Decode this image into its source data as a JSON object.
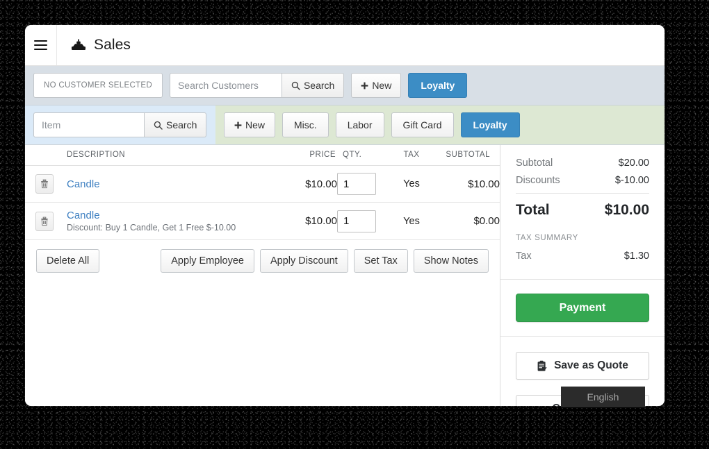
{
  "app": {
    "title": "Sales",
    "title_icon": "cash-register-icon",
    "menu_icon": "hamburger-menu-icon"
  },
  "colors": {
    "primary_blue": "#3c8dc5",
    "payment_green": "#35a851",
    "customer_bar_bg": "#d8dfe6",
    "item_search_bg": "#dbeaf8",
    "item_actions_bg": "#dde8d3",
    "link_blue": "#3d7fc1"
  },
  "customer_bar": {
    "selected_customer": "NO CUSTOMER SELECTED",
    "search_placeholder": "Search Customers",
    "search_value": "",
    "search_button": "Search",
    "new_button": "New",
    "loyalty_button": "Loyalty"
  },
  "item_bar": {
    "item_placeholder": "Item",
    "item_value": "",
    "search_button": "Search",
    "buttons": [
      {
        "label": "New",
        "style": "default",
        "icon": "plus-icon"
      },
      {
        "label": "Misc.",
        "style": "default"
      },
      {
        "label": "Labor",
        "style": "default"
      },
      {
        "label": "Gift Card",
        "style": "default"
      },
      {
        "label": "Loyalty",
        "style": "primary"
      }
    ]
  },
  "cart": {
    "columns": {
      "description": "DESCRIPTION",
      "price": "PRICE",
      "qty": "QTY.",
      "tax": "TAX",
      "subtotal": "SUBTOTAL"
    },
    "rows": [
      {
        "delete_icon": "trash-icon",
        "name": "Candle",
        "note": "",
        "price": "$10.00",
        "qty": "1",
        "tax": "Yes",
        "subtotal": "$10.00"
      },
      {
        "delete_icon": "trash-icon",
        "name": "Candle",
        "note": "Discount: Buy 1 Candle, Get 1 Free $-10.00",
        "price": "$10.00",
        "qty": "1",
        "tax": "Yes",
        "subtotal": "$0.00"
      }
    ],
    "actions": {
      "delete_all": "Delete All",
      "apply_employee": "Apply Employee",
      "apply_discount": "Apply Discount",
      "set_tax": "Set Tax",
      "show_notes": "Show Notes"
    }
  },
  "totals": {
    "subtotal_label": "Subtotal",
    "subtotal_value": "$20.00",
    "discounts_label": "Discounts",
    "discounts_value": "$-10.00",
    "total_label": "Total",
    "total_value": "$10.00",
    "tax_summary_label": "TAX SUMMARY",
    "tax_label": "Tax",
    "tax_value": "$1.30"
  },
  "sidebar_actions": {
    "payment": "Payment",
    "save_as_quote": "Save as Quote",
    "save_as_quote_icon": "clipboard-icon",
    "cancel_sale": "Cancel Sale"
  },
  "overlay": {
    "language": "English"
  }
}
